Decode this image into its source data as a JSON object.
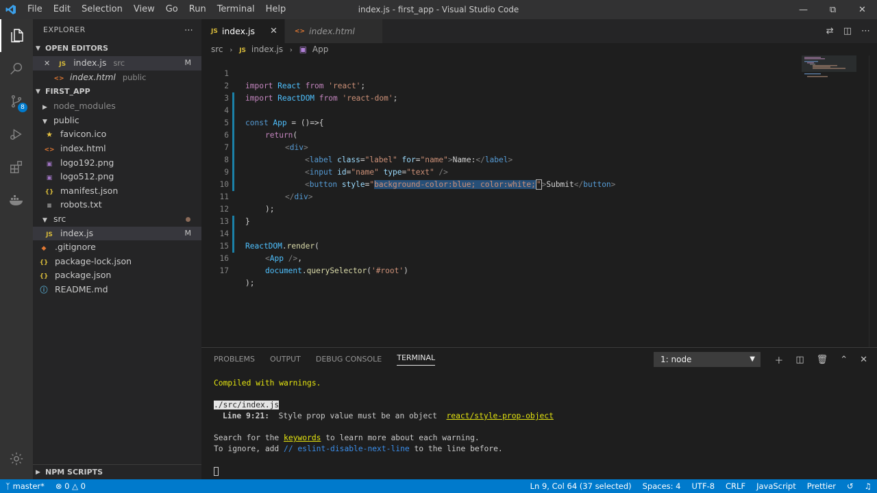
{
  "window": {
    "title": "index.js - first_app - Visual Studio Code",
    "menu": [
      "File",
      "Edit",
      "Selection",
      "View",
      "Go",
      "Run",
      "Terminal",
      "Help"
    ]
  },
  "activity_bar": {
    "scm_badge": "8"
  },
  "sidebar": {
    "title": "EXPLORER",
    "open_editors_label": "OPEN EDITORS",
    "open_editors": [
      {
        "name": "index.js",
        "desc": "src",
        "badge": "M"
      },
      {
        "name": "index.html",
        "desc": "public"
      }
    ],
    "project_label": "FIRST_APP",
    "tree": [
      {
        "name": "node_modules"
      },
      {
        "name": "public"
      },
      {
        "name": "favicon.ico"
      },
      {
        "name": "index.html"
      },
      {
        "name": "logo192.png"
      },
      {
        "name": "logo512.png"
      },
      {
        "name": "manifest.json"
      },
      {
        "name": "robots.txt"
      },
      {
        "name": "src"
      },
      {
        "name": "index.js",
        "badge": "M"
      },
      {
        "name": ".gitignore"
      },
      {
        "name": "package-lock.json"
      },
      {
        "name": "package.json"
      },
      {
        "name": "README.md"
      }
    ],
    "npm_scripts_label": "NPM SCRIPTS"
  },
  "tabs": [
    {
      "label": "index.js",
      "icon": "JS"
    },
    {
      "label": "index.html",
      "icon": "<>"
    }
  ],
  "breadcrumb": {
    "folder": "src",
    "file": "index.js",
    "symbol": "App"
  },
  "editor": {
    "line_numbers": [
      "1",
      "2",
      "3",
      "4",
      "5",
      "6",
      "7",
      "8",
      "9",
      "10",
      "11",
      "12",
      "13",
      "14",
      "15",
      "16",
      "17"
    ],
    "code": {
      "l1": [
        "import",
        " React ",
        "from",
        " 'react'",
        ";"
      ],
      "l2": [
        "import",
        " ReactDOM ",
        "from",
        " 'react-dom'",
        ";"
      ],
      "l4": [
        "const",
        " App",
        " = ()=>{"
      ],
      "l5": [
        "return",
        "("
      ],
      "l6": [
        "<",
        "div",
        ">"
      ],
      "l7": [
        "<",
        "label",
        " class",
        "=",
        "\"label\"",
        " for",
        "=",
        "\"name\"",
        ">",
        "Name:",
        "</",
        "label",
        ">"
      ],
      "l8": [
        "<",
        "input",
        " id",
        "=",
        "\"name\"",
        " type",
        "=",
        "\"text\"",
        " />"
      ],
      "l9": [
        "<",
        "button",
        " style",
        "=",
        "\"",
        "background-color:blue; color:white;",
        "\"",
        ">",
        "Submit",
        "</",
        "button",
        ">"
      ],
      "l10": [
        "</",
        "div",
        ">"
      ],
      "l11": [
        ");"
      ],
      "l12": [
        "}"
      ],
      "l14": [
        "ReactDOM",
        ".",
        "render",
        "("
      ],
      "l15": [
        "<",
        "App",
        " />",
        ","
      ],
      "l16": [
        "document",
        ".",
        "querySelector",
        "(",
        "'#root'",
        ")"
      ],
      "l17": [
        ");"
      ]
    }
  },
  "panel": {
    "tabs": [
      "PROBLEMS",
      "OUTPUT",
      "DEBUG CONSOLE",
      "TERMINAL"
    ],
    "terminal_select": "1: node",
    "terminal": {
      "compiled": "Compiled with warnings.",
      "file": "./src/index.js",
      "line_ref": "Line 9:21:",
      "warning": "Style prop value must be an object",
      "rule": "react/style-prop-object",
      "search_pre": "Search for the ",
      "search_kw": "keywords",
      "search_post": " to learn more about each warning.",
      "ignore_pre": "To ignore, add ",
      "ignore_kw": "// eslint-disable-next-line",
      "ignore_post": " to the line before."
    }
  },
  "statusbar": {
    "branch": "master*",
    "errors": "0",
    "warnings": "0",
    "position": "Ln 9, Col 64 (37 selected)",
    "spaces": "Spaces: 4",
    "encoding": "UTF-8",
    "eol": "CRLF",
    "language": "JavaScript",
    "formatter": "Prettier"
  },
  "colors": {
    "accent": "#007acc",
    "selection": "#264f78",
    "warning_yellow": "#e5e510"
  }
}
